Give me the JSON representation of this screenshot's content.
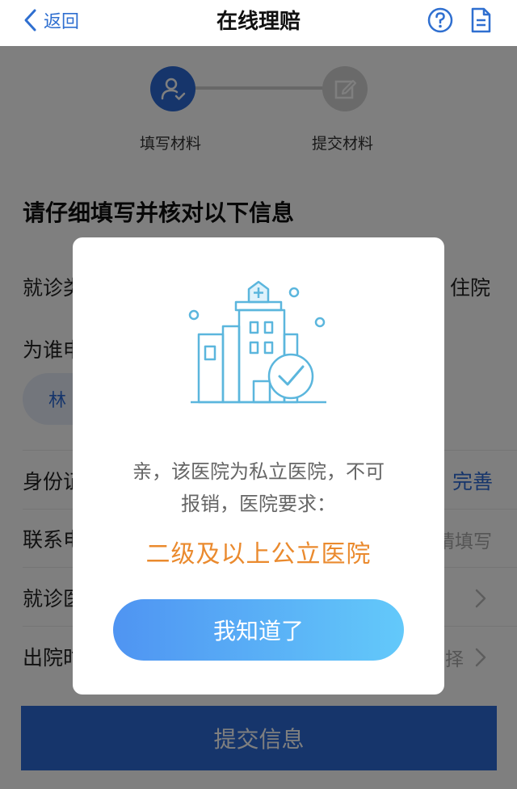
{
  "nav": {
    "back_label": "返回",
    "title": "在线理赔"
  },
  "steps": [
    {
      "label": "填写材料"
    },
    {
      "label": "提交材料"
    }
  ],
  "form": {
    "section_title": "请仔细填写并核对以下信息",
    "visit_type_label": "就诊类",
    "visit_type_value": "住院",
    "claim_for_label": "为谁申",
    "patient_chip": "林",
    "id_label": "身份证",
    "id_action": "完善",
    "contact_label": "联系电",
    "contact_placeholder": "请填写",
    "hospital_label": "就诊医",
    "discharge_label": "出院时",
    "discharge_placeholder": "择"
  },
  "submit": {
    "label": "提交信息"
  },
  "modal": {
    "message_line1": "亲，该医院为私立医院，不可",
    "message_line2": "报销，医院要求：",
    "highlight": "二级及以上公立医院",
    "confirm_label": "我知道了"
  },
  "colors": {
    "primary": "#2d6bd6",
    "highlight": "#ea8a2e",
    "art_outline": "#5bb6dd"
  }
}
